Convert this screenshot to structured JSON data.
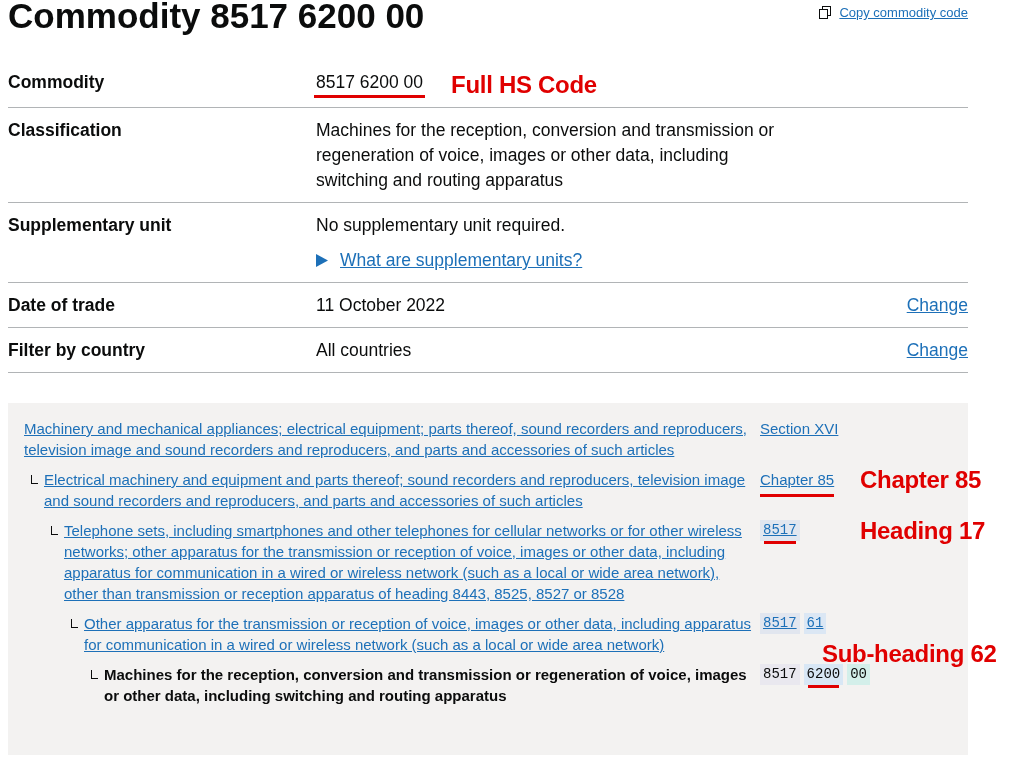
{
  "page_title": "Commodity 8517 6200 00",
  "copy_link": "Copy commodity code",
  "summary": [
    {
      "label": "Commodity",
      "value": "8517 6200 00",
      "marked": true,
      "annotation": "Full HS Code"
    },
    {
      "label": "Classification",
      "value": "Machines for the reception, conversion and transmission or regeneration of voice, images or other data, including switching and routing apparatus",
      "marked": false
    },
    {
      "label": "Supplementary unit",
      "value": "No supplementary unit required.",
      "marked": false,
      "details": {
        "summary": "What are supplementary units?",
        "expanded": false
      }
    },
    {
      "label": "Date of trade",
      "value": "11 October 2022",
      "marked": false,
      "action": "Change"
    },
    {
      "label": "Filter by country",
      "value": "All countries",
      "marked": false,
      "action": "Change"
    }
  ],
  "hierarchy": [
    {
      "text": "Machinery and mechanical appliances; electrical equipment; parts thereof, sound recorders and reproducers, television image and sound recorders and reproducers, and parts and accessories of such articles",
      "current": false,
      "code": [
        {
          "text": "Section XVI",
          "kind": "link",
          "marked": false
        }
      ],
      "children": [
        {
          "text": "Electrical machinery and equipment and parts thereof; sound recorders and reproducers, television image and sound recorders and reproducers, and parts and accessories of such articles",
          "current": false,
          "code": [
            {
              "text": "Chapter 85",
              "kind": "link",
              "marked": true
            }
          ],
          "annotation": "Chapter 85",
          "children": [
            {
              "text": "Telephone sets, including smartphones and other telephones for cellular networks or for other wireless networks; other apparatus for the transmission or reception of voice, images or other data, including apparatus for communication in a wired or wireless network (such as a local or wide area network), other than transmission or reception apparatus of heading 8443, 8525, 8527 or 8528",
              "current": false,
              "code": [
                {
                  "text": "8517",
                  "kind": "chip",
                  "color": "#e1e6ef",
                  "marked": true
                }
              ],
              "annotation": "Heading 17",
              "children": [
                {
                  "text": "Other apparatus for the transmission or reception of voice, images or other data, including apparatus for communication in a wired or wireless network (such as a local or wide area network)",
                  "current": false,
                  "code": [
                    {
                      "text": "8517",
                      "kind": "chip",
                      "color": "#e1e6ef",
                      "marked": false
                    },
                    {
                      "text": "61",
                      "kind": "chip",
                      "color": "#dbe7f4",
                      "marked": false
                    }
                  ],
                  "children": [
                    {
                      "text": "Machines for the reception, conversion and transmission or regeneration of voice, images or other data, including switching and routing apparatus",
                      "current": true,
                      "code": [
                        {
                          "text": "8517",
                          "kind": "chip",
                          "color": "#e9e8ef",
                          "marked": false
                        },
                        {
                          "text": "6200",
                          "kind": "chip",
                          "color": "#d8e7f5",
                          "marked": true
                        },
                        {
                          "text": "00",
                          "kind": "chip",
                          "color": "#d3efea",
                          "marked": false
                        }
                      ],
                      "annotation": "Sub-heading 62"
                    }
                  ]
                }
              ]
            }
          ]
        }
      ]
    }
  ]
}
